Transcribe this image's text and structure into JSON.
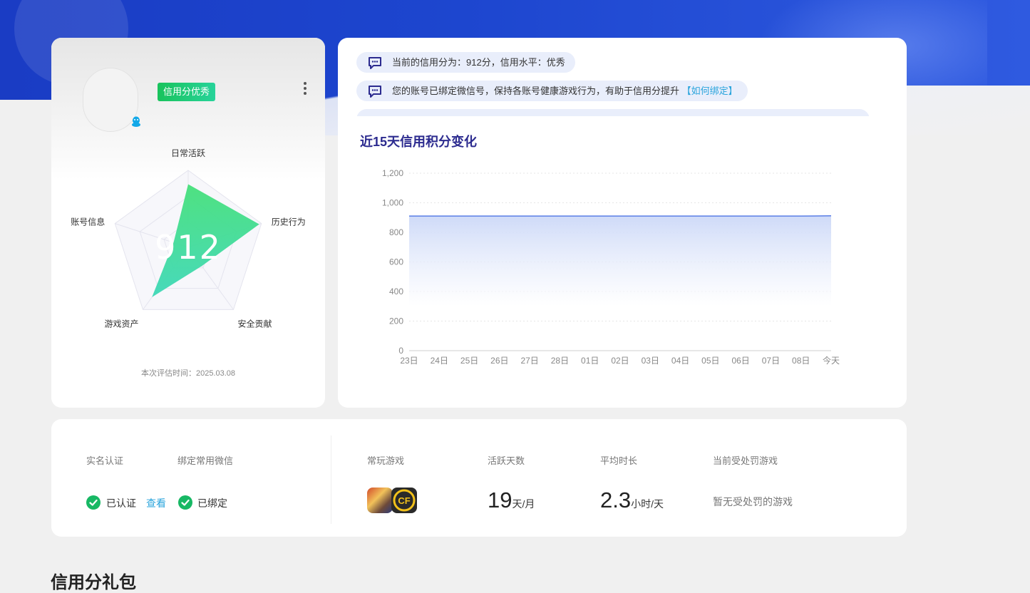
{
  "profile": {
    "badge": "信用分优秀",
    "score": "912",
    "eval_time": "本次评估时间：2025.03.08",
    "radar": {
      "axes": [
        "日常活跃",
        "历史行为",
        "安全贡献",
        "游戏资产",
        "账号信息"
      ],
      "values": [
        0.82,
        0.97,
        0.3,
        0.8,
        0.2
      ],
      "fill_colors": [
        "#46e07a",
        "#3ed8b8"
      ]
    }
  },
  "messages": [
    {
      "text": "当前的信用分为：912分，信用水平：优秀",
      "link": ""
    },
    {
      "text": "您的账号已绑定微信号，保持各账号健康游戏行为，有助于信用分提升",
      "link": "【如何绑定】"
    }
  ],
  "chart": {
    "title": "近15天信用积分变化",
    "chart_data": {
      "type": "area",
      "x": [
        "23日",
        "24日",
        "25日",
        "26日",
        "27日",
        "28日",
        "01日",
        "02日",
        "03日",
        "04日",
        "05日",
        "06日",
        "07日",
        "08日",
        "今天"
      ],
      "y_ticks": [
        "0",
        "200",
        "400",
        "600",
        "800",
        "1,000",
        "1,200"
      ],
      "ylim": [
        0,
        1200
      ],
      "series": [
        {
          "values": [
            910,
            910,
            910,
            910,
            910,
            910,
            910,
            910,
            910,
            910,
            910,
            910,
            910,
            910,
            912
          ]
        }
      ],
      "line_color": "#5b7fe6",
      "grid": true
    }
  },
  "stats": {
    "realname_label": "实名认证",
    "wechat_label": "绑定常用微信",
    "verified_text": "已认证",
    "view_link": "查看",
    "bound_text": "已绑定",
    "games_label": "常玩游戏",
    "active_days_label": "活跃天数",
    "active_days_value": "19",
    "active_days_unit": "天/月",
    "avg_time_label": "平均时长",
    "avg_time_value": "2.3",
    "avg_time_unit": "小时/天",
    "penalty_label": "当前受处罚游戏",
    "penalty_text": "暂无受处罚的游戏"
  },
  "gift_title": "信用分礼包",
  "colors": {
    "accent": "#2c2b8f",
    "green": "#17b864",
    "link": "#2aa4dc",
    "hero": "#1d46cf"
  }
}
